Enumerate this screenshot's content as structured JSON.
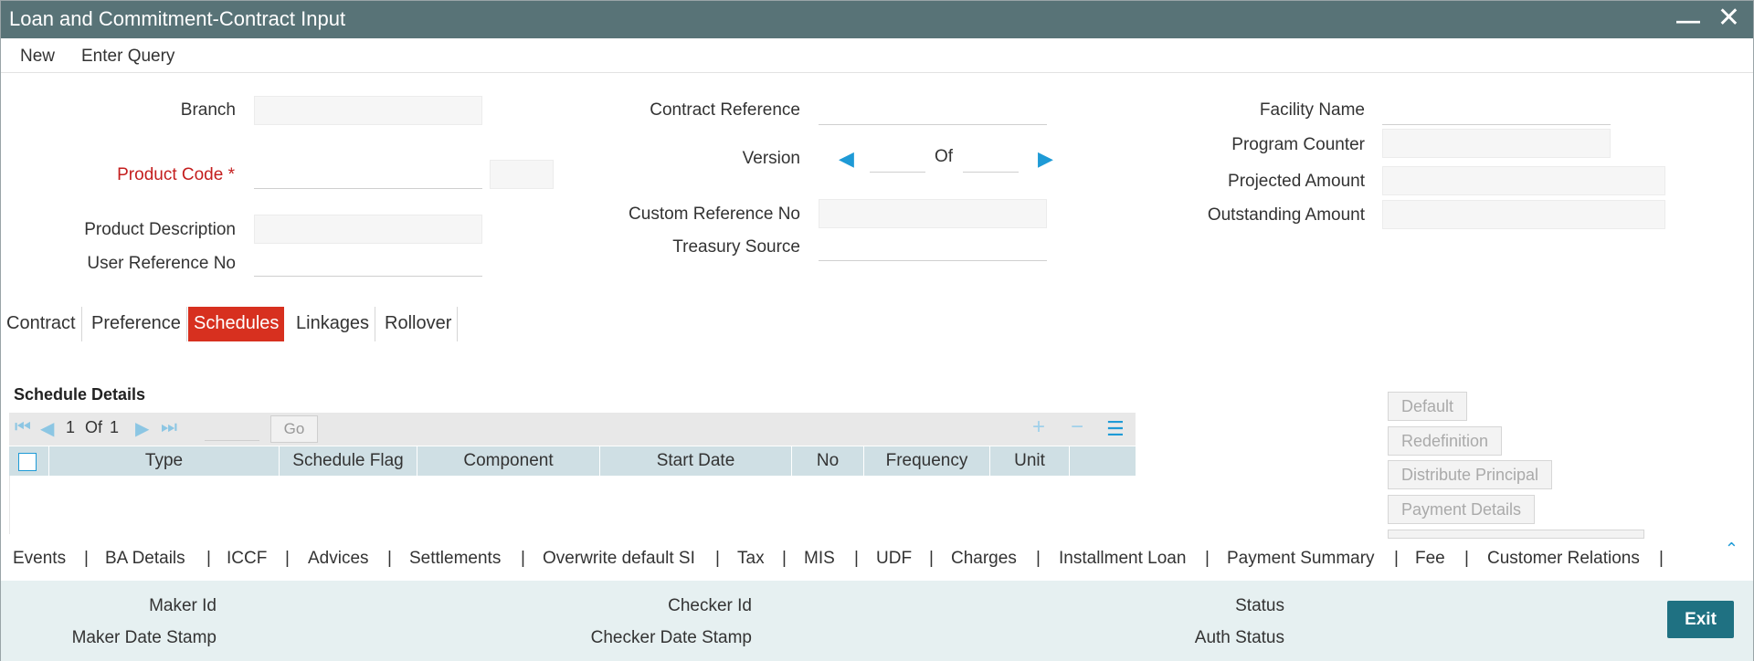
{
  "window": {
    "title": "Loan and Commitment-Contract Input",
    "minimize_icon": "minimize-icon",
    "close_icon": "close-icon"
  },
  "menu": {
    "new": "New",
    "enter_query": "Enter Query"
  },
  "form": {
    "branch_label": "Branch",
    "product_code_label": "Product Code",
    "required_mark": "*",
    "product_description_label": "Product Description",
    "user_reference_label": "User Reference No",
    "contract_reference_label": "Contract Reference",
    "version_label": "Version",
    "version_of": "Of",
    "custom_reference_label": "Custom Reference No",
    "treasury_source_label": "Treasury Source",
    "facility_name_label": "Facility Name",
    "program_counter_label": "Program Counter",
    "projected_amount_label": "Projected Amount",
    "outstanding_amount_label": "Outstanding Amount"
  },
  "tabs": [
    {
      "label": "Contract"
    },
    {
      "label": "Preference"
    },
    {
      "label": "Schedules",
      "active": true
    },
    {
      "label": "Linkages"
    },
    {
      "label": "Rollover"
    }
  ],
  "schedule": {
    "title": "Schedule Details",
    "page_current": "1",
    "page_of": "Of",
    "page_total": "1",
    "go_label": "Go",
    "columns": [
      "Type",
      "Schedule Flag",
      "Component",
      "Start Date",
      "No",
      "Frequency",
      "Unit"
    ]
  },
  "side_buttons": {
    "default": "Default",
    "redefinition": "Redefinition",
    "distribute_principal": "Distribute Principal",
    "payment_details": "Payment Details"
  },
  "bottom_links": [
    "Events",
    "BA Details",
    "ICCF",
    "Advices",
    "Settlements",
    "Overwrite default SI",
    "Tax",
    "MIS",
    "UDF",
    "Charges",
    "Installment Loan",
    "Payment Summary",
    "Fee",
    "Customer Relations"
  ],
  "separator": "|",
  "footer": {
    "maker_id": "Maker Id",
    "maker_date_stamp": "Maker Date Stamp",
    "checker_id": "Checker Id",
    "checker_date_stamp": "Checker Date Stamp",
    "status": "Status",
    "auth_status": "Auth Status",
    "exit": "Exit"
  },
  "colors": {
    "titlebar": "#587377",
    "active_tab": "#d7301f",
    "accent": "#1e9ad6",
    "exit_button": "#1f7182",
    "footer_bg": "#e6f0f1",
    "grid_header": "#cfdfe4"
  }
}
